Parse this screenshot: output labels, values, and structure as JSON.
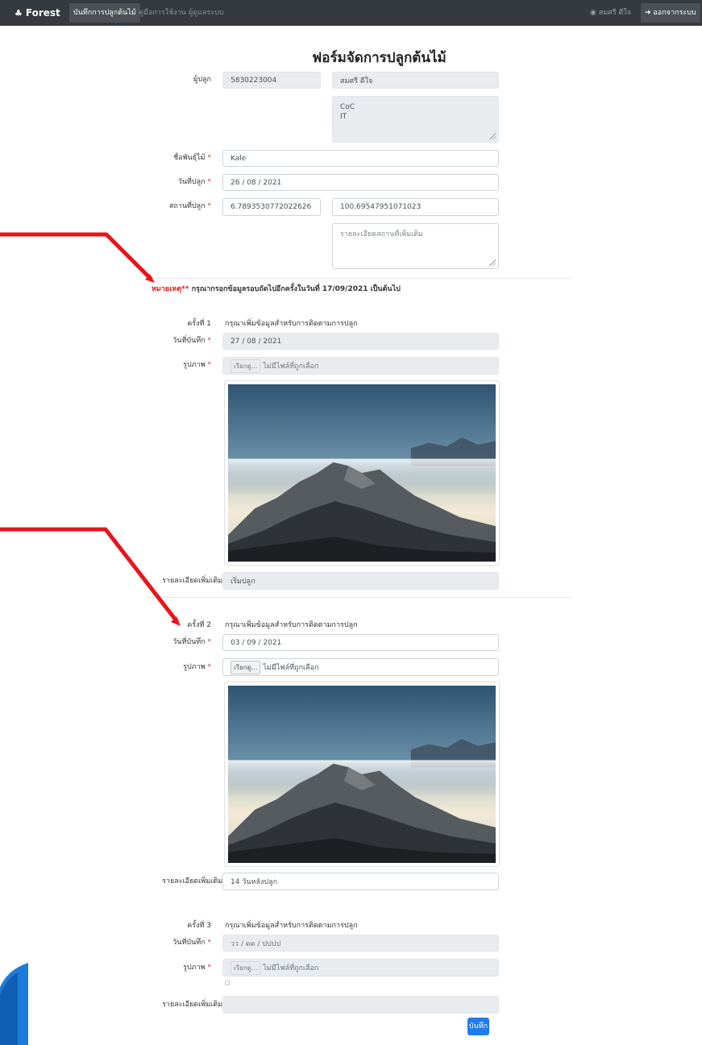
{
  "navbar": {
    "brand": "Forest",
    "active_item": "บันทึกการปลูกต้นไม้",
    "items": [
      "คู่มือการใช้งาน",
      "ผู้ดูแลระบบ"
    ],
    "user": "สมศรี ดีใจ",
    "logout": "ออกจากระบบ"
  },
  "page_title": "ฟอร์มจัดการปลูกต้นไม้",
  "planter": {
    "label": "ผู้ปลูก",
    "id": "5830223004",
    "name": "สมศรี ดีใจ",
    "org": "CoC\nIT"
  },
  "species": {
    "label": "ชื่อพันธุ์ไม้",
    "value": "Kale"
  },
  "plant_date": {
    "label": "วันที่ปลูก",
    "value": "26 / 08 / 2021"
  },
  "location": {
    "label": "สถานที่ปลูก",
    "lat": "6.7893530772022626",
    "lng": "100.69547951071023",
    "detail_placeholder": "รายละเอียดสถานที่เพิ่มเติม"
  },
  "note": {
    "prefix": "หมายเหตุ**",
    "text": " กรุณากรอกข้อมูลรอบถัดไปอีกครั้งในวันที่ 17/09/2021 เป็นต้นไป"
  },
  "rounds": [
    {
      "label": "ครั้งที่ 1",
      "prompt": "กรุณาเพิ่มข้อมูลสำหรับการติดตามการปลูก",
      "date_label": "วันที่บันทึก",
      "date": "27 / 08 / 2021",
      "image_label": "รูปภาพ",
      "file_button": "เรียกดู...",
      "file_status": "ไม่มีไฟล์ที่ถูกเลือก",
      "detail_label": "รายละเอียดเพิ่มเติม",
      "detail": "เริ่มปลูก"
    },
    {
      "label": "ครั้งที่ 2",
      "prompt": "กรุณาเพิ่มข้อมูลสำหรับการติดตามการปลูก",
      "date_label": "วันที่บันทึก",
      "date": "03 / 09 / 2021",
      "image_label": "รูปภาพ",
      "file_button": "เรียกดู...",
      "file_status": "ไม่มีไฟล์ที่ถูกเลือก",
      "detail_label": "รายละเอียดเพิ่มเติม",
      "detail": "14 วันหลังปลูก"
    },
    {
      "label": "ครั้งที่ 3",
      "prompt": "กรุณาเพิ่มข้อมูลสำหรับการติดตามการปลูก",
      "date_label": "วันที่บันทึก",
      "date": "วว / ดด / ปปปป",
      "image_label": "รูปภาพ",
      "file_button": "เรียกดู...",
      "file_status": "ไม่มีไฟล์ที่ถูกเลือก",
      "detail_label": "รายละเอียดเพิ่มเติม",
      "detail": ""
    }
  ],
  "required_mark": "*",
  "save_button": "บันทึก",
  "colors": {
    "navbar": "#343a40",
    "primary": "#1e7bf0",
    "required": "#dc3545",
    "annotation_arrow": "#e8141b"
  },
  "icons": {
    "brand": "tree-icon",
    "user": "user-circle-icon",
    "logout": "sign-out-icon"
  }
}
